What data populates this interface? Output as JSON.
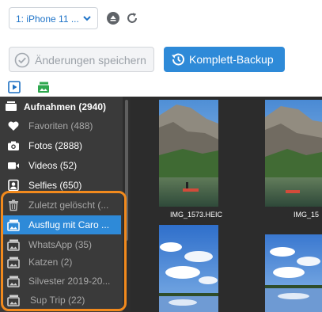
{
  "toolbar": {
    "device_select": "1: iPhone 11 ...",
    "save_label": "Änderungen speichern",
    "backup_label": "Komplett-Backup"
  },
  "tabs": [
    {
      "icon": "media-icon"
    },
    {
      "icon": "album-icon"
    }
  ],
  "sidebar": {
    "header": "Aufnahmen (2940)",
    "items": [
      {
        "label": "Favoriten (488)",
        "icon": "heart-icon",
        "state": "dim"
      },
      {
        "label": "Fotos (2888)",
        "icon": "camera-icon",
        "state": "light"
      },
      {
        "label": "Videos (52)",
        "icon": "video-icon",
        "state": "light"
      },
      {
        "label": "Selfies (650)",
        "icon": "portrait-icon",
        "state": "light"
      },
      {
        "label": "Zuletzt gelöscht (...",
        "icon": "trash-icon",
        "state": "dim"
      },
      {
        "label": "Ausflug mit Caro ...",
        "icon": "album-icon",
        "state": "selected"
      },
      {
        "label": "WhatsApp (35)",
        "icon": "album-icon",
        "state": "dim"
      },
      {
        "label": "Katzen  (2)",
        "icon": "album-icon",
        "state": "dim"
      },
      {
        "label": "Silvester 2019-20...",
        "icon": "album-icon",
        "state": "dim"
      },
      {
        "label": "Sup Trip (22)",
        "icon": "album-icon",
        "state": "dim"
      }
    ]
  },
  "photos": [
    {
      "caption": "IMG_1573.HEIC"
    },
    {
      "caption": "IMG_15"
    },
    {
      "caption": ""
    },
    {
      "caption": ""
    }
  ],
  "colors": {
    "accent": "#2e8ad8",
    "highlight": "#f28a1d",
    "sidebar_bg": "#3a3a3a",
    "grid_bg": "#2c2c2c"
  }
}
